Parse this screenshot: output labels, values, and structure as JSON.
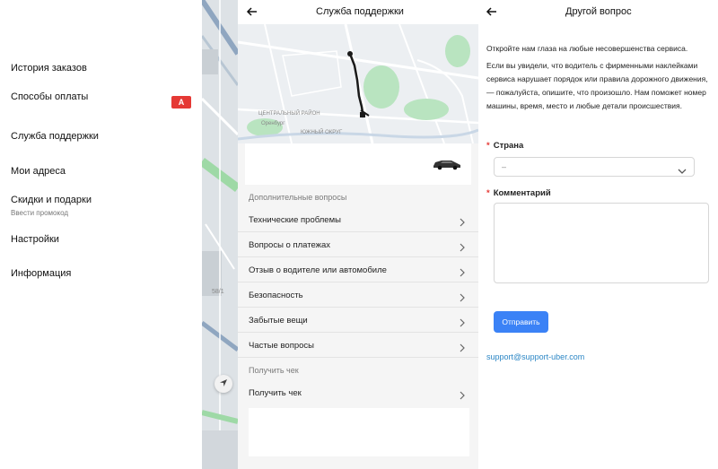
{
  "menu": {
    "items": [
      {
        "label": "История заказов"
      },
      {
        "label": "Способы оплаты",
        "badge": "А"
      },
      {
        "label": "Служба поддержки"
      },
      {
        "label": "Мои адреса"
      },
      {
        "label": "Скидки и подарки",
        "sublabel": "Ввести промокод"
      },
      {
        "label": "Настройки"
      },
      {
        "label": "Информация"
      }
    ],
    "map_label": "58/1"
  },
  "support": {
    "title": "Служба поддержки",
    "map_labels": {
      "city": "Оренбург",
      "district1": "ЦЕНТРАЛЬНЫЙ РАЙОН",
      "district2": "ЮЖНЫЙ ОКРУГ"
    },
    "section_additional": "Дополнительные вопросы",
    "questions": [
      {
        "label": "Технические проблемы"
      },
      {
        "label": "Вопросы о платежах"
      },
      {
        "label": "Отзыв о водителе или автомобиле"
      },
      {
        "label": "Безопасность"
      },
      {
        "label": "Забытые вещи"
      },
      {
        "label": "Частые вопросы"
      }
    ],
    "section_receipt": "Получить чек",
    "receipt_item": "Получить чек"
  },
  "form": {
    "title": "Другой вопрос",
    "intro": "Откройте нам глаза на любые несовершенства сервиса.",
    "description": "Если вы увидели, что водитель с фирменными наклейками сервиса нарушает порядок или правила дорожного движения, — пожалуйста, опишите, что произошло. Нам поможет номер машины, время, место и любые детали происшествия.",
    "country_label": "Страна",
    "country_value": "–",
    "comment_label": "Комментарий",
    "comment_value": "",
    "send_label": "Отправить",
    "email": "support@support-uber.com"
  },
  "colors": {
    "accent": "#3b82f6",
    "required": "#e53935",
    "link": "#2b86c5",
    "badge": "#e53935"
  }
}
